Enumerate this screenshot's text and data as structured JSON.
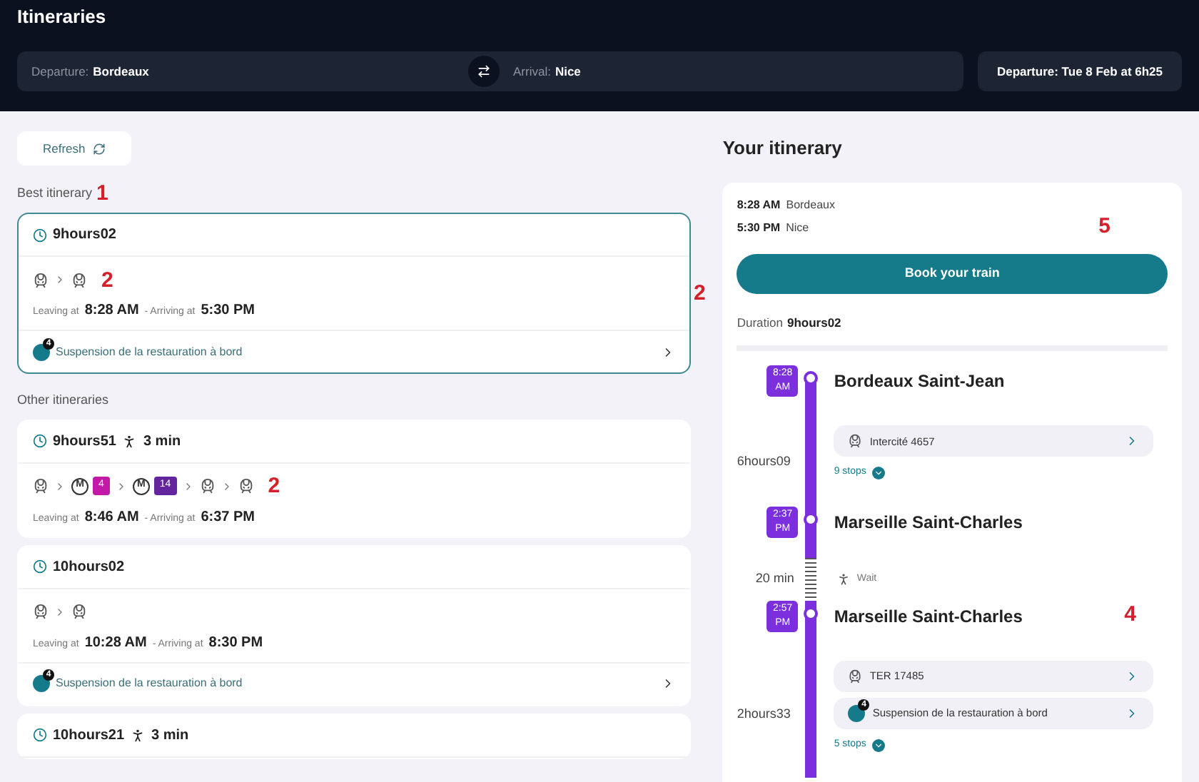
{
  "header": {
    "title": "Itineraries",
    "departure": {
      "label": "Departure:",
      "value": "Bordeaux"
    },
    "arrival": {
      "label": "Arrival:",
      "value": "Nice"
    },
    "date": "Departure: Tue 8 Feb at 6h25"
  },
  "refresh_button": "Refresh",
  "best": {
    "heading": "Best itinerary",
    "annotation": "1",
    "side_annotation": "2",
    "itinerary": {
      "duration": "9hours02",
      "selected": true,
      "segments": [
        {
          "kind": "train"
        },
        {
          "kind": "train"
        }
      ],
      "segments_annotation": "2",
      "leaving_label": "Leaving at",
      "departure": "8:28 AM",
      "arriving_label": "- Arriving at",
      "arrival": "5:30 PM",
      "alert": {
        "badge": "4",
        "text": "Suspension de la restauration à bord"
      }
    }
  },
  "others": {
    "heading": "Other itineraries",
    "itineraries": [
      {
        "duration": "9hours51",
        "walk": "3 min",
        "selected": false,
        "segments": [
          {
            "kind": "train"
          },
          {
            "kind": "metro",
            "symbol": "M",
            "line": "4",
            "color": "#c21aa6"
          },
          {
            "kind": "metro",
            "symbol": "M",
            "line": "14",
            "color": "#62259d"
          },
          {
            "kind": "train"
          },
          {
            "kind": "train"
          }
        ],
        "segments_annotation": "2",
        "leaving_label": "Leaving at",
        "departure": "8:46 AM",
        "arriving_label": "- Arriving at",
        "arrival": "6:37 PM"
      },
      {
        "duration": "10hours02",
        "selected": false,
        "segments": [
          {
            "kind": "train"
          },
          {
            "kind": "train"
          }
        ],
        "leaving_label": "Leaving at",
        "departure": "10:28 AM",
        "arriving_label": "- Arriving at",
        "arrival": "8:30 PM",
        "alert": {
          "badge": "4",
          "text": "Suspension de la restauration à bord"
        }
      },
      {
        "duration": "10hours21",
        "walk": "3 min",
        "selected": false
      }
    ]
  },
  "your_itinerary": {
    "title": "Your itinerary",
    "summary": [
      {
        "time": "8:28 AM",
        "place": "Bordeaux"
      },
      {
        "time": "5:30 PM",
        "place": "Nice"
      }
    ],
    "annotation": "5",
    "book_button": "Book your train",
    "duration_label": "Duration",
    "duration": "9hours02",
    "timeline": [
      {
        "kind": "stop",
        "time": "8:28 AM",
        "name": "Bordeaux Saint-Jean"
      },
      {
        "kind": "leg",
        "duration": "6hours09",
        "chips": [
          {
            "kind": "train",
            "text": "Intercité 4657"
          }
        ],
        "stops": "9 stops",
        "expanded": false
      },
      {
        "kind": "stop",
        "time": "2:37 PM",
        "name": "Marseille Saint-Charles"
      },
      {
        "kind": "wait",
        "duration": "20 min",
        "text": "Wait"
      },
      {
        "kind": "stop",
        "time": "2:57 PM",
        "name": "Marseille Saint-Charles",
        "annotation": "4"
      },
      {
        "kind": "leg",
        "duration": "2hours33",
        "chips": [
          {
            "kind": "train",
            "text": "TER 17485"
          },
          {
            "kind": "alert",
            "badge": "4",
            "text": "Suspension de la restauration à bord"
          }
        ],
        "stops": "5 stops",
        "expanded": false
      }
    ]
  }
}
